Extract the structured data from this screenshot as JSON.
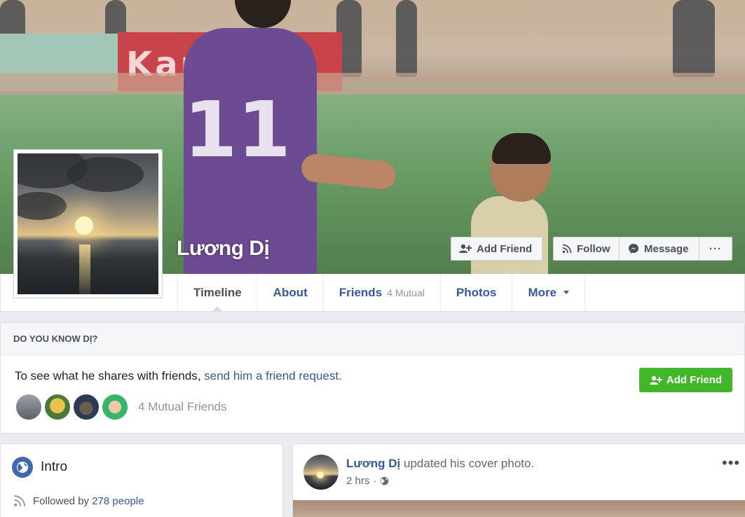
{
  "profile": {
    "name": "Lương Dị",
    "cover_alt": "cover-photo",
    "cover_banner_text": "Kappa"
  },
  "cover_actions": {
    "add_friend": "Add Friend",
    "follow": "Follow",
    "message": "Message",
    "more": "···"
  },
  "nav": {
    "tabs": [
      {
        "label": "Timeline",
        "sub": ""
      },
      {
        "label": "About",
        "sub": ""
      },
      {
        "label": "Friends",
        "sub": "4 Mutual"
      },
      {
        "label": "Photos",
        "sub": ""
      },
      {
        "label": "More",
        "sub": ""
      }
    ]
  },
  "know": {
    "title": "DO YOU KNOW DỊ?",
    "text_prefix": "To see what he shares with friends, ",
    "text_link": "send him a friend request.",
    "add_friend": "Add Friend",
    "mutual_count": "4 Mutual Friends"
  },
  "intro": {
    "title": "Intro",
    "followed_prefix": "Followed by ",
    "followed_link": "278 people"
  },
  "post": {
    "author": "Lương Dị",
    "action": " updated his cover photo.",
    "time": "2 hrs",
    "dot": "·",
    "more": "•••"
  },
  "colors": {
    "brand_link": "#365899",
    "add_green": "#42b72a",
    "page_bg": "#e9ebee"
  }
}
